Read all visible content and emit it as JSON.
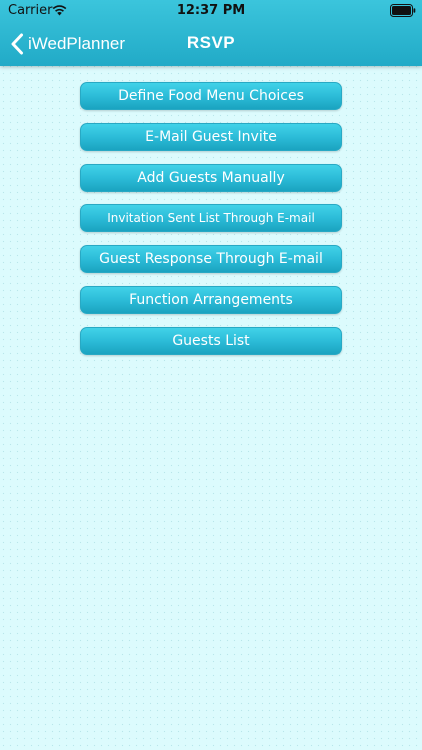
{
  "status_bar": {
    "carrier": "Carrier",
    "time": "12:37 PM"
  },
  "nav": {
    "back_label": "iWedPlanner",
    "title": "RSVP"
  },
  "menu": {
    "items": [
      {
        "label": "Define Food Menu Choices"
      },
      {
        "label": "E-Mail Guest Invite"
      },
      {
        "label": "Add Guests Manually"
      },
      {
        "label": "Invitation Sent List Through E-mail"
      },
      {
        "label": "Guest Response Through E-mail"
      },
      {
        "label": "Function Arrangements"
      },
      {
        "label": "Guests List"
      }
    ]
  },
  "colors": {
    "nav_bar": "#2cb8d3",
    "button": "#2cbcd8",
    "background": "#dcfbfd"
  }
}
